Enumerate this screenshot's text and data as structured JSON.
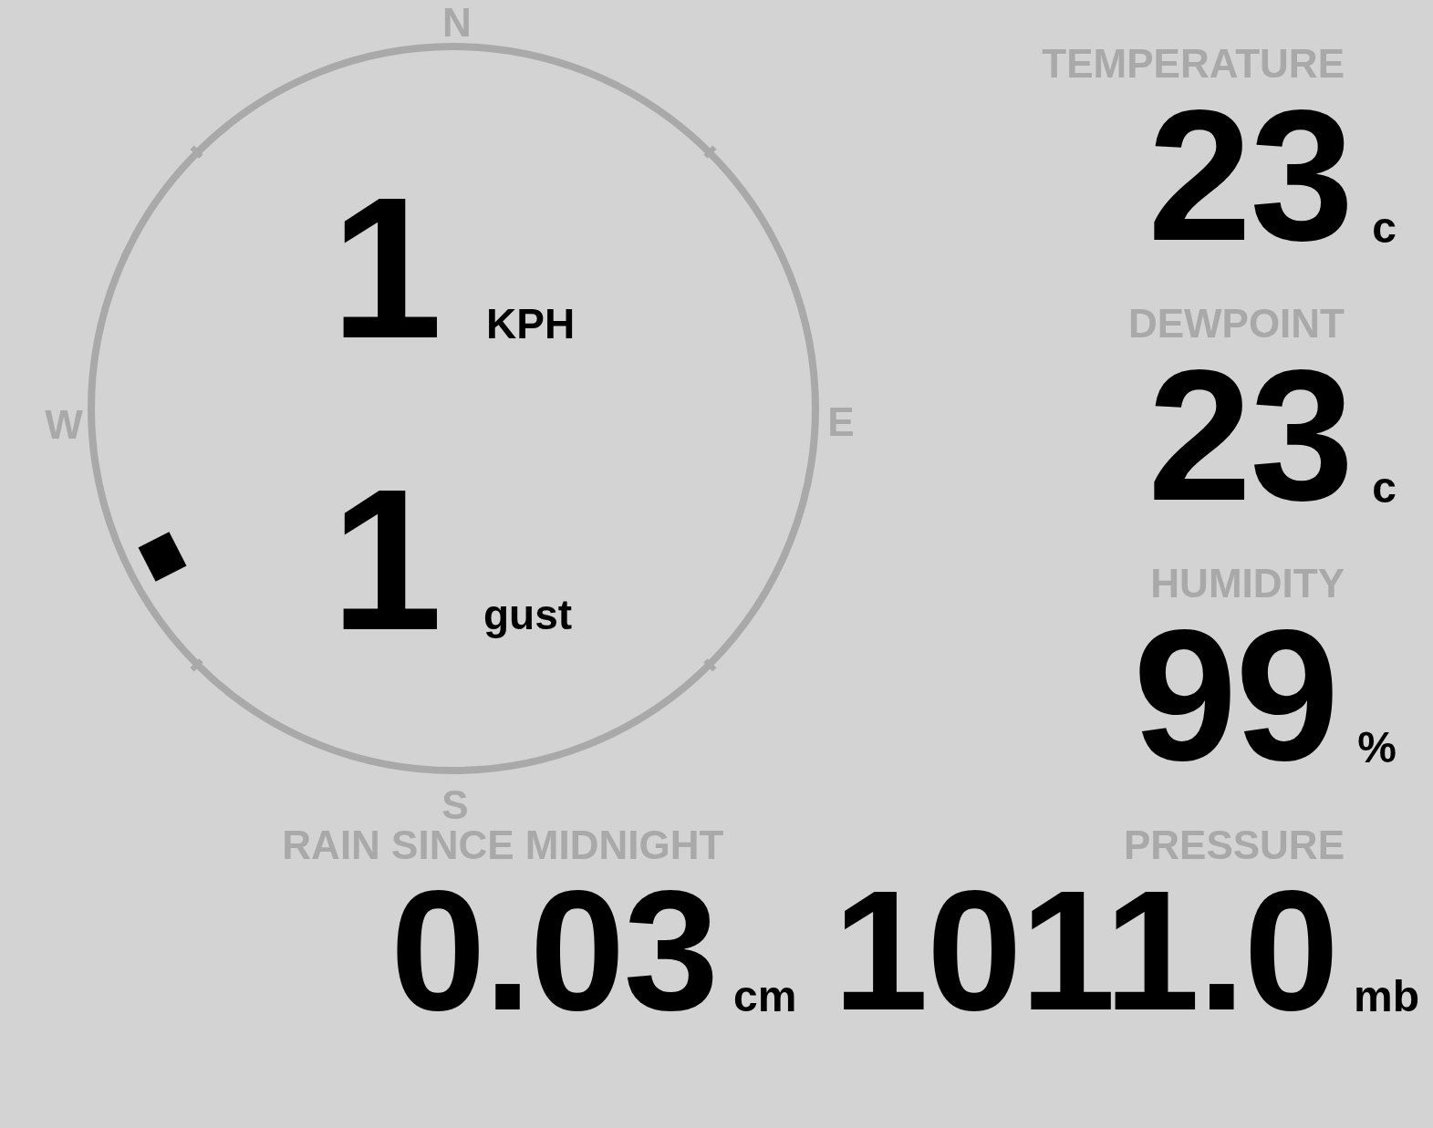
{
  "compass": {
    "north": "N",
    "east": "E",
    "south": "S",
    "west": "W",
    "speed": {
      "value": "1",
      "unit": "KPH"
    },
    "gust": {
      "value": "1",
      "unit": "gust"
    }
  },
  "stats": [
    {
      "label": "TEMPERATURE",
      "value": "23",
      "unit": "c"
    },
    {
      "label": "DEWPOINT",
      "value": "23",
      "unit": "c"
    },
    {
      "label": "HUMIDITY",
      "value": "99",
      "unit": "%"
    }
  ],
  "rain": {
    "label": "RAIN SINCE MIDNIGHT",
    "value": "0.03",
    "unit": "cm"
  },
  "pressure": {
    "label": "PRESSURE",
    "value": "1011.0",
    "unit": "mb"
  }
}
